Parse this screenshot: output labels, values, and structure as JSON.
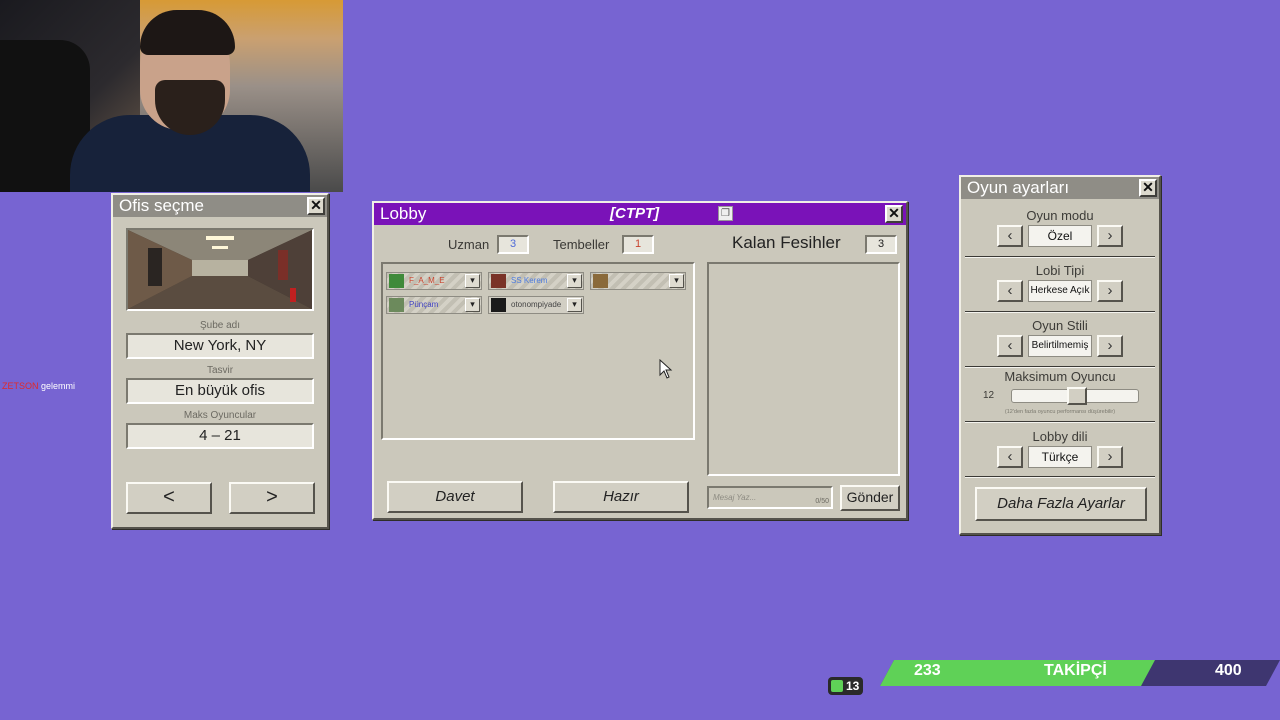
{
  "chat": {
    "user": "ZETSON",
    "message": "gelemmi"
  },
  "office_window": {
    "title": "Ofis seçme",
    "branch_label": "Şube adı",
    "branch_value": "New York, NY",
    "desc_label": "Tasvir",
    "desc_value": "En büyük ofis",
    "max_label": "Maks Oyuncular",
    "max_value": "4 – 21",
    "prev": "<",
    "next": ">"
  },
  "lobby_window": {
    "title": "Lobby",
    "code": "[CTPT]",
    "uzman_label": "Uzman",
    "uzman_value": "3",
    "tembeller_label": "Tembeller",
    "tembeller_value": "1",
    "kalan_label": "Kalan Fesihler",
    "kalan_value": "3",
    "players": [
      {
        "name": "F_A_M_E",
        "color": "#c8442f"
      },
      {
        "name": "SS Kerem",
        "color": "#4c7be0"
      },
      {
        "name": "",
        "color": "#5c9e54"
      },
      {
        "name": "Pünçam",
        "color": "#3d3fc1"
      },
      {
        "name": "otonompiyade",
        "color": "#444444"
      }
    ],
    "invite_button": "Davet",
    "ready_button": "Hazır",
    "message_placeholder": "Mesaj Yaz...",
    "message_counter": "0/50",
    "send_button": "Gönder"
  },
  "settings_window": {
    "title": "Oyun ayarları",
    "game_mode_label": "Oyun modu",
    "game_mode_value": "Özel",
    "lobby_type_label": "Lobi Tipi",
    "lobby_type_value": "Herkese Açık",
    "game_style_label": "Oyun Stili",
    "game_style_value": "Belirtilmemiş",
    "max_players_label": "Maksimum Oyuncu",
    "max_players_value": "12",
    "max_players_slider": 0.52,
    "max_players_note": "(12'den fazla oyuncu performansı düşürebilir)",
    "lang_label": "Lobby dili",
    "lang_value": "Türkçe",
    "more_settings": "Daha Fazla Ayarlar"
  },
  "stream_overlay": {
    "viewers": "13",
    "follow_current": "233",
    "follow_label": "TAKİPÇİ",
    "follow_goal": "400",
    "follow_progress": 0.58
  }
}
